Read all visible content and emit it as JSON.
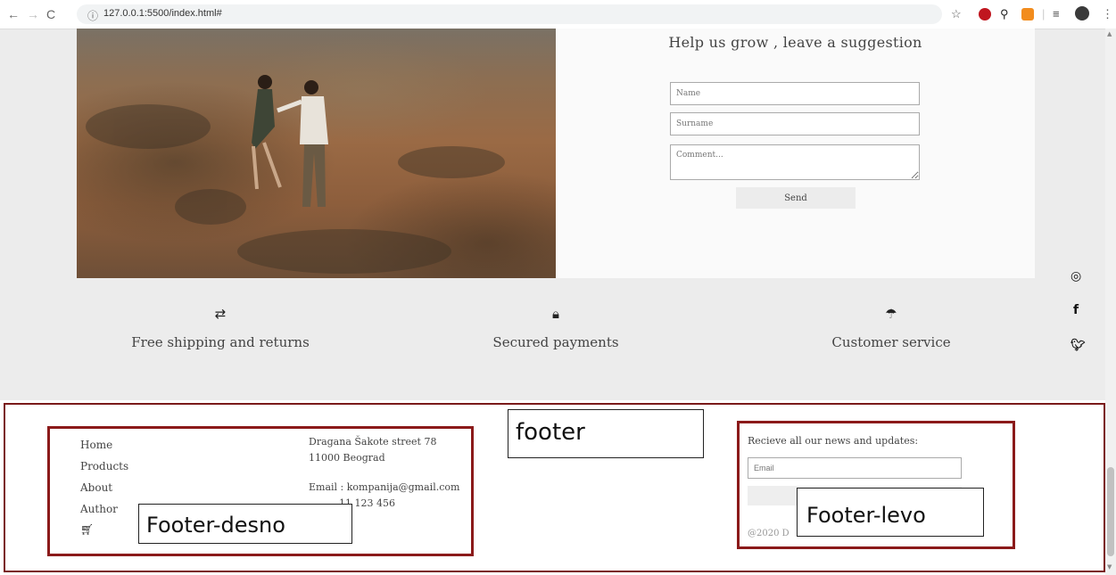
{
  "browser": {
    "url": "127.0.0.1:5500/index.html#"
  },
  "form": {
    "title": "Help us grow , leave a suggestion",
    "name_placeholder": "Name",
    "surname_placeholder": "Surname",
    "comment_placeholder": "Comment...",
    "send_label": "Send"
  },
  "features": [
    {
      "icon": "retweet-icon",
      "label": "Free shipping and returns"
    },
    {
      "icon": "lock-icon",
      "label": "Secured payments"
    },
    {
      "icon": "umbrella-icon",
      "label": "Customer service"
    }
  ],
  "social": [
    "instagram-icon",
    "facebook-icon",
    "twitter-icon"
  ],
  "footer": {
    "nav": [
      "Home",
      "Products",
      "About",
      "Author"
    ],
    "address_line1": "Dragana Šakote street 78",
    "address_line2": "11000 Beograd",
    "email": "Email : kompanija@gmail.com",
    "phone_partial": "11 123 456",
    "news_title": "Recieve all our news and updates:",
    "news_placeholder": "Email",
    "copyright_partial": "@2020 D"
  },
  "annotations": {
    "footer": "footer",
    "footer_desno": "Footer-desno",
    "footer_levo": "Footer-levo"
  },
  "colors": {
    "annotation_border": "#8b1a1a",
    "page_bg": "#ececec"
  }
}
